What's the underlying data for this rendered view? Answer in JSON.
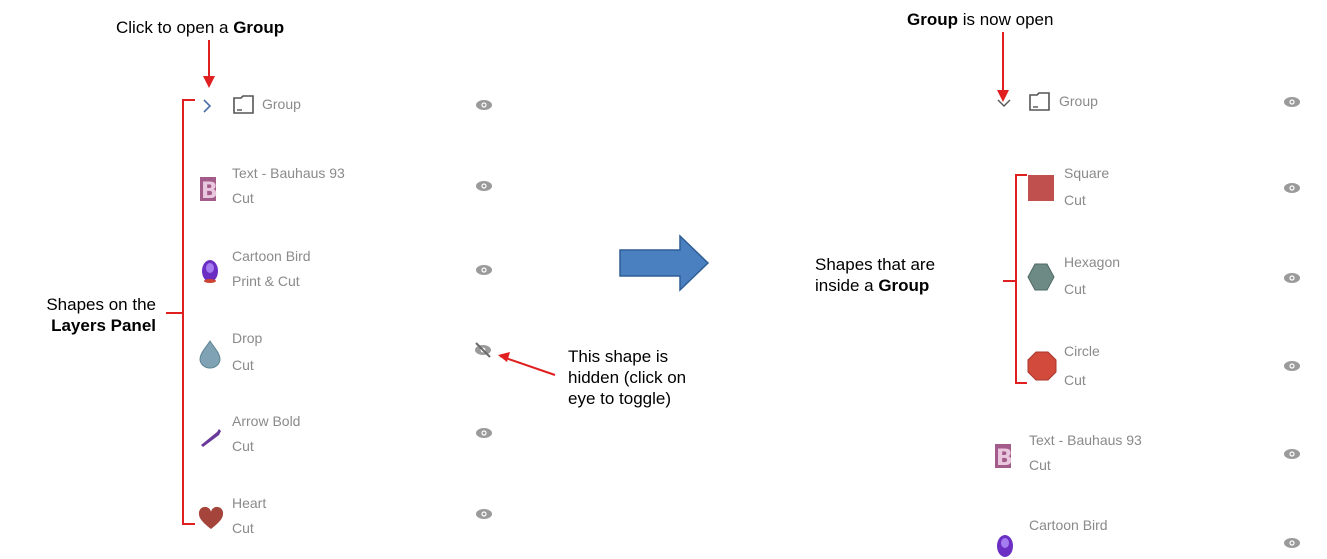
{
  "annotations": {
    "click_open_prefix": "Click to open a ",
    "click_open_bold": "Group",
    "group_open_bold": "Group",
    "group_open_suffix": " is now open",
    "shapes_on_line1": "Shapes on the",
    "shapes_on_bold": "Layers Panel",
    "hidden_line1": "This shape is",
    "hidden_line2": "hidden (click on",
    "hidden_line3": "eye to toggle)",
    "inside_line1": "Shapes that are",
    "inside_prefix": "inside a ",
    "inside_bold": "Group"
  },
  "left_panel": {
    "group": {
      "label": "Group",
      "icon": "folder-icon",
      "expand": "chevron-right-icon"
    },
    "layers": [
      {
        "name": "Text - Bauhaus 93",
        "sub": "Cut",
        "thumb": "letter-b-icon",
        "visible": true
      },
      {
        "name": "Cartoon Bird",
        "sub": "Print & Cut",
        "thumb": "cartoon-bird-icon",
        "visible": true
      },
      {
        "name": "Drop",
        "sub": "Cut",
        "thumb": "drop-icon",
        "visible": false
      },
      {
        "name": "Arrow Bold",
        "sub": "Cut",
        "thumb": "arrow-bold-icon",
        "visible": true
      },
      {
        "name": "Heart",
        "sub": "Cut",
        "thumb": "heart-icon",
        "visible": true
      }
    ]
  },
  "right_panel": {
    "group": {
      "label": "Group",
      "icon": "folder-icon",
      "expand": "chevron-down-icon"
    },
    "children": [
      {
        "name": "Square",
        "sub": "Cut",
        "thumb": "square-icon",
        "color": "#c0504d"
      },
      {
        "name": "Hexagon",
        "sub": "Cut",
        "thumb": "hexagon-icon",
        "color": "#6e8a84"
      },
      {
        "name": "Circle",
        "sub": "Cut",
        "thumb": "circle-icon",
        "color": "#d24a3c"
      }
    ],
    "layers": [
      {
        "name": "Text - Bauhaus 93",
        "sub": "Cut",
        "thumb": "letter-b-icon"
      },
      {
        "name": "Cartoon Bird",
        "sub": "",
        "thumb": "cartoon-bird-icon"
      }
    ]
  },
  "colors": {
    "annotation_red": "#e02020",
    "transition_arrow": "#3f76b5",
    "layer_text": "#8a8a8a"
  }
}
